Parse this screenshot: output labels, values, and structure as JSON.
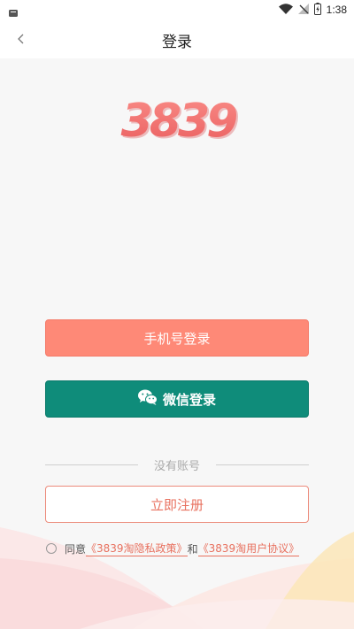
{
  "status_bar": {
    "time": "1:38"
  },
  "nav": {
    "title": "登录"
  },
  "logo": {
    "text": "3839"
  },
  "buttons": {
    "phone_login": "手机号登录",
    "wechat_login": "微信登录",
    "register": "立即注册"
  },
  "divider": {
    "text": "没有账号"
  },
  "agreement": {
    "prefix": "同意",
    "privacy_link": "《3839淘隐私政策》",
    "conjunction": "和",
    "user_agreement_link": "《3839淘用户协议》"
  },
  "colors": {
    "phone_button": "#fe8977",
    "wechat_button": "#0f8c7a",
    "accent": "#e8715f"
  }
}
